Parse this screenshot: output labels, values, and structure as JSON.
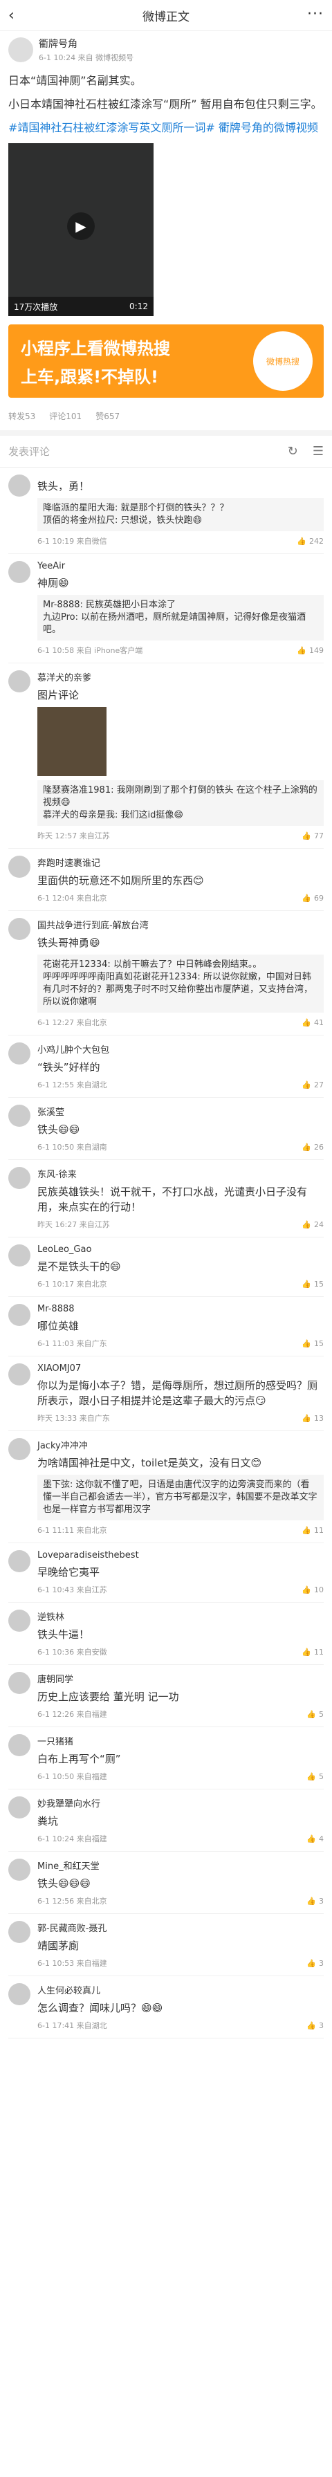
{
  "topbar": {
    "title": "微博正文",
    "back_icon": "chevron-left-icon",
    "more_icon": "more-icon"
  },
  "author": {
    "name": "衢牌号角",
    "sub": "6-1 10:24  来自 微博视频号"
  },
  "post": {
    "title": "日本“靖国神厕”名副其实。",
    "body": "小日本靖国神社石柱被红漆涂写“厕所” 暂用自布包住只剩三字。",
    "hashtag1": "#靖国神社石柱被红漆涂写英文厕所一词#",
    "extra": "衢牌号角的微博视频"
  },
  "video": {
    "views": "17万次播放",
    "duration": "0:12"
  },
  "banner": {
    "line1": "小程序上看微博热搜",
    "line2": "上车,跟紧!不掉队!",
    "qr_label": "微博热搜"
  },
  "stats": {
    "reposts": "转发53",
    "comments": "评论101",
    "likes": "赞657"
  },
  "compose": {
    "placeholder": "发表评论"
  },
  "comments": [
    {
      "name": "",
      "text": "铁头，勇！",
      "meta": "6-1 10:19  来自微信",
      "likes": "242",
      "replies": [
        "降临派的星阳大海: 就是那个打倒的铁头？？？",
        "顶佰的将金州拉尺: 只想说，铁头快跑😄"
      ]
    },
    {
      "name": "YeeAir",
      "text": "神厕😄",
      "meta": "6-1 10:58  来自 iPhone客户端",
      "likes": "149",
      "replies": [
        "Mr-8888: 民族英雄把小日本涂了",
        "九边Pro: 以前在扬州酒吧，厕所就是靖国神厕，记得好像是夜猫酒吧。"
      ]
    },
    {
      "name": "慕洋犬的亲爹",
      "text": "图片评论",
      "meta": "昨天 12:57  来自江苏",
      "likes": "77",
      "image": true,
      "replies": [
        "隆瑟赛洛准1981: 我刚刚刷到了那个打倒的铁头 在这个柱子上涂鸦的视频😄",
        "慕洋犬的母亲是我: 我们这id挺像😄"
      ]
    },
    {
      "name": "奔跑时速裹谁记",
      "text": "里面供的玩意还不如厕所里的东西😊",
      "meta": "6-1 12:04  来自北京",
      "likes": "69"
    },
    {
      "name": "国共战争进行到底-解放台湾",
      "text": "铁头哥神勇😄",
      "meta": "6-1 12:27  来自北京",
      "likes": "41",
      "replies": [
        "花谢花开12334: 以前干嘛去了？中日韩峰会刚结束。。",
        "呼呼呼呼呼呼南阳真如花谢花开12334: 所以说你就嫩，中国对日韩有几时不好的？那两鬼子时不时又给你整出市厦萨道，又支持台湾，所以说你嫩啊"
      ]
    },
    {
      "name": "小鸡儿肿个大包包",
      "text": "“铁头”好样的",
      "meta": "6-1 12:55  来自湖北",
      "likes": "27"
    },
    {
      "name": "张溪莹",
      "text": "铁头😄😄",
      "meta": "6-1 10:50  来自湖南",
      "likes": "26"
    },
    {
      "name": "东风-徐来",
      "text": "民族英雄铁头！说干就干，不打口水战，光谴责小日子没有用，来点实在的行动！",
      "meta": "昨天 16:27  来自江苏",
      "likes": "24"
    },
    {
      "name": "LeoLeo_Gao",
      "text": "是不是铁头干的😄",
      "meta": "6-1 10:17  来自北京",
      "likes": "15"
    },
    {
      "name": "Mr-8888",
      "text": "哪位英雄",
      "meta": "6-1 11:03  来自广东",
      "likes": "15"
    },
    {
      "name": "XIAOMJ07",
      "text": "你以为是悔小本子？错，是侮辱厕所，想过厕所的感受吗？厕所表示，跟小日子相提并论是这辈子最大的污点😏",
      "meta": "昨天 13:33  来自广东",
      "likes": "13"
    },
    {
      "name": "Jacky冲冲冲",
      "text": "为啥靖国神社是中文，toilet是英文，没有日文😊",
      "meta": "6-1 11:11  来自北京",
      "likes": "11",
      "replies": [
        "墨下弦: 这你就不懂了吧，日语是由唐代汉字的边旁演变而来的（看懂一半自己都会适去一半），官方书写都是汉字，韩国要不是改革文字也是一样官方书写都用汉字"
      ]
    },
    {
      "name": "Loveparadiseisthebest",
      "text": "早晚给它夷平",
      "meta": "6-1 10:43  来自江苏",
      "likes": "10"
    },
    {
      "name": "逆铁林",
      "text": "铁头牛逼！",
      "meta": "6-1 10:36  来自安徽",
      "likes": "11"
    },
    {
      "name": "唐朝同学",
      "text": "历史上应该要给 董光明 记一功",
      "meta": "6-1 12:26  来自福建",
      "likes": "5"
    },
    {
      "name": "一只猪猪",
      "text": "白布上再写个“厕”",
      "meta": "6-1 10:50  来自福建",
      "likes": "5"
    },
    {
      "name": "妙我犟犟向水行",
      "text": "粪坑",
      "meta": "6-1 10:24  来自福建",
      "likes": "4"
    },
    {
      "name": "Mine_和红天堂",
      "text": "铁头😄😄😄",
      "meta": "6-1 12:56  来自北京",
      "likes": "3"
    },
    {
      "name": "郭-民藏商败-聂孔",
      "text": "靖國茅廁",
      "meta": "6-1 10:53  来自福建",
      "likes": "3"
    },
    {
      "name": "人生何必较真儿",
      "text": "怎么调查？闻味儿吗？😄😄",
      "meta": "6-1 17:41  来自湖北",
      "likes": "3"
    }
  ],
  "colors": {
    "accent": "#1d7fd7",
    "banner": "#ff9b19"
  }
}
